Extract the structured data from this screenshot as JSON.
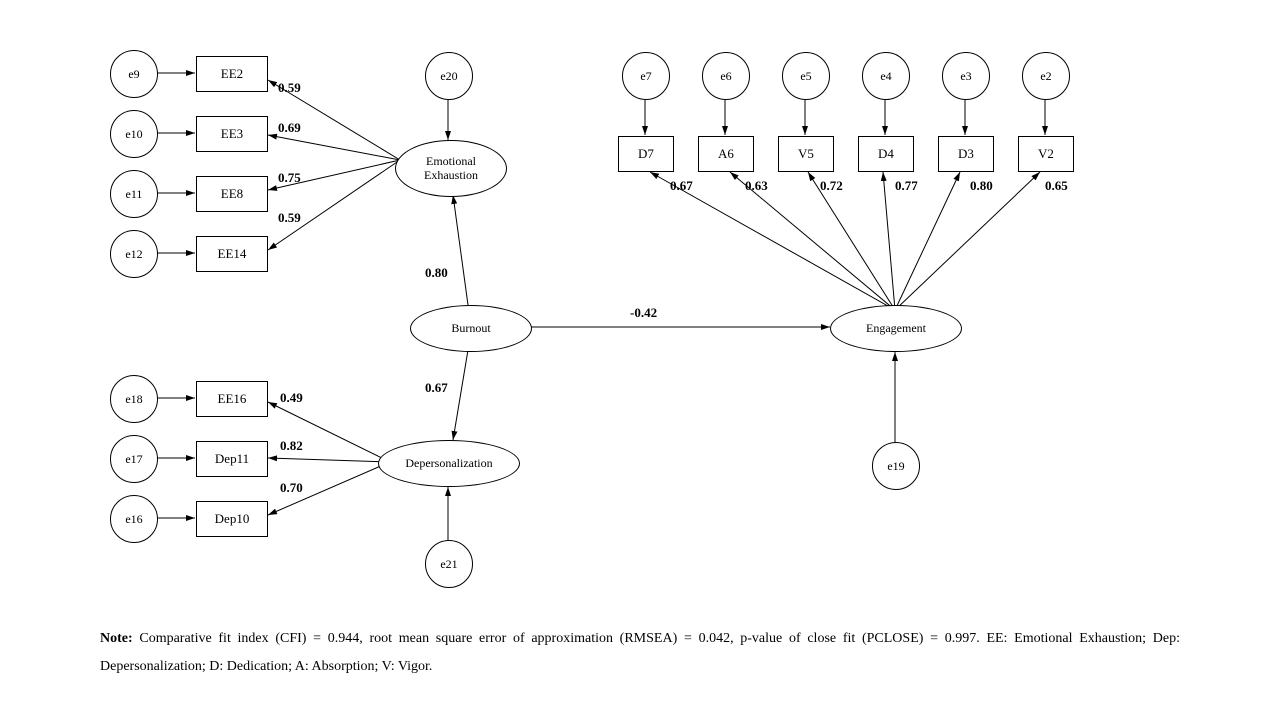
{
  "errors": {
    "e9": "e9",
    "e10": "e10",
    "e11": "e11",
    "e12": "e12",
    "e18": "e18",
    "e17": "e17",
    "e16": "e16",
    "e20": "e20",
    "e21": "e21",
    "e19": "e19",
    "e7": "e7",
    "e6": "e6",
    "e5": "e5",
    "e4": "e4",
    "e3": "e3",
    "e2": "e2"
  },
  "indicators": {
    "EE2": "EE2",
    "EE3": "EE3",
    "EE8": "EE8",
    "EE14": "EE14",
    "EE16": "EE16",
    "Dep11": "Dep11",
    "Dep10": "Dep10",
    "D7": "D7",
    "A6": "A6",
    "V5": "V5",
    "D4": "D4",
    "D3": "D3",
    "V2": "V2"
  },
  "latent": {
    "emotional_exhaustion": "Emotional\nExhaustion",
    "burnout": "Burnout",
    "depersonalization": "Depersonalization",
    "engagement": "Engagement"
  },
  "loadings": {
    "EE2": "0.59",
    "EE3": "0.69",
    "EE8": "0.75",
    "EE14": "0.59",
    "EE16": "0.49",
    "Dep11": "0.82",
    "Dep10": "0.70",
    "D7": "0.67",
    "A6": "0.63",
    "V5": "0.72",
    "D4": "0.77",
    "D3": "0.80",
    "V2": "0.65"
  },
  "paths": {
    "burnout_to_ee": "0.80",
    "burnout_to_dep": "0.67",
    "burnout_to_engagement": "-0.42"
  },
  "note_label": "Note:",
  "note_body": " Comparative fit index (CFI) = 0.944, root mean square error of approximation (RMSEA) = 0.042, p-value of close fit (PCLOSE) = 0.997. EE: Emotional Exhaustion; Dep: Depersonalization;  D: Dedication; A: Absorption; V: Vigor.",
  "chart_data": {
    "type": "sem_path_diagram",
    "latent_variables": [
      "Emotional Exhaustion",
      "Burnout",
      "Depersonalization",
      "Engagement"
    ],
    "factor_loadings": {
      "Emotional Exhaustion": {
        "EE2": 0.59,
        "EE3": 0.69,
        "EE8": 0.75,
        "EE14": 0.59
      },
      "Depersonalization": {
        "EE16": 0.49,
        "Dep11": 0.82,
        "Dep10": 0.7
      },
      "Engagement": {
        "D7": 0.67,
        "A6": 0.63,
        "V5": 0.72,
        "D4": 0.77,
        "D3": 0.8,
        "V2": 0.65
      }
    },
    "structural_paths": {
      "Burnout -> Emotional Exhaustion": 0.8,
      "Burnout -> Depersonalization": 0.67,
      "Burnout -> Engagement": -0.42
    },
    "error_terms": {
      "EE2": "e9",
      "EE3": "e10",
      "EE8": "e11",
      "EE14": "e12",
      "EE16": "e18",
      "Dep11": "e17",
      "Dep10": "e16",
      "D7": "e7",
      "A6": "e6",
      "V5": "e5",
      "D4": "e4",
      "D3": "e3",
      "V2": "e2",
      "Emotional Exhaustion": "e20",
      "Depersonalization": "e21",
      "Engagement": "e19"
    },
    "fit_indices": {
      "CFI": 0.944,
      "RMSEA": 0.042,
      "PCLOSE": 0.997
    },
    "legend": {
      "EE": "Emotional Exhaustion",
      "Dep": "Depersonalization",
      "D": "Dedication",
      "A": "Absorption",
      "V": "Vigor"
    }
  }
}
